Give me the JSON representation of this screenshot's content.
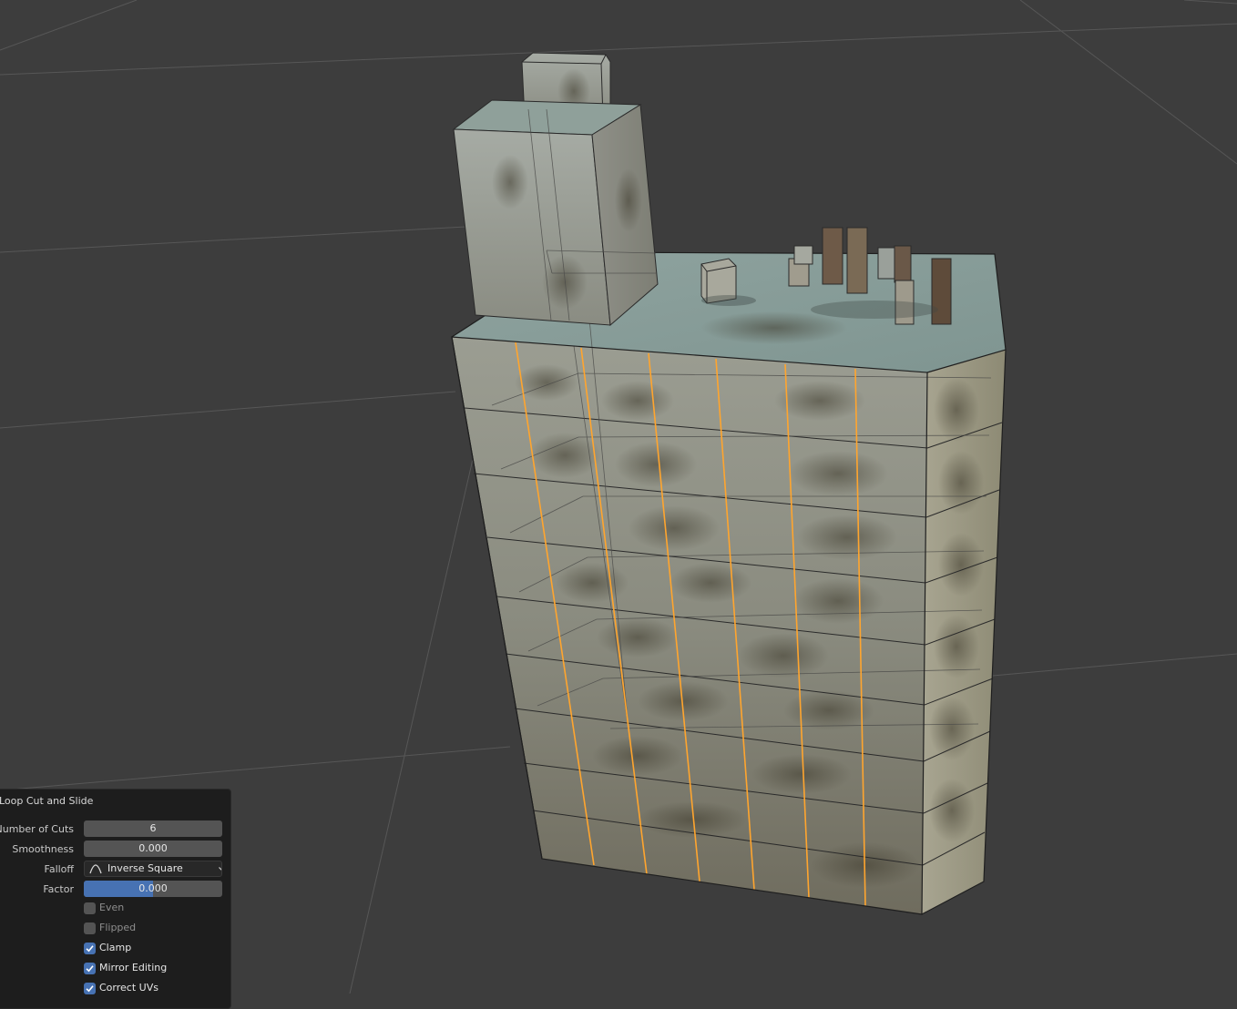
{
  "operator_panel": {
    "title": "Loop Cut and Slide",
    "number_of_cuts": {
      "label": "Number of Cuts",
      "value": "6"
    },
    "smoothness": {
      "label": "Smoothness",
      "value": "0.000"
    },
    "falloff": {
      "label": "Falloff",
      "value": "Inverse Square",
      "icon": "inverse-square-curve-icon"
    },
    "factor": {
      "label": "Factor",
      "value": "0.000",
      "slider_fraction": 0.5
    },
    "options": [
      {
        "label": "Even",
        "checked": false
      },
      {
        "label": "Flipped",
        "checked": false
      },
      {
        "label": "Clamp",
        "checked": true
      },
      {
        "label": "Mirror Editing",
        "checked": true
      },
      {
        "label": "Correct UVs",
        "checked": true
      }
    ]
  },
  "viewport": {
    "background_color": "#3d3d3d",
    "grid_color": "#565656",
    "edge_highlight_color": "#ffa52e",
    "object": "building-mesh"
  }
}
